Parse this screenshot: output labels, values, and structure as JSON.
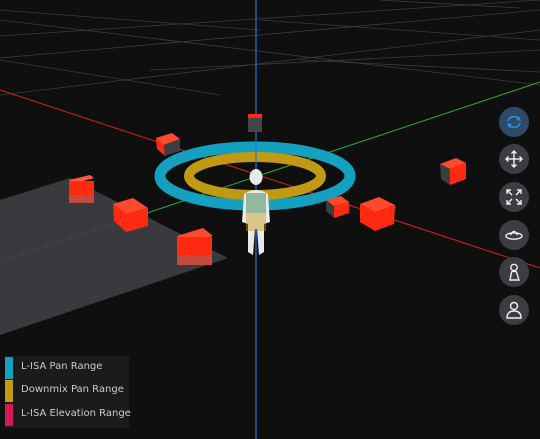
{
  "colors": {
    "background": "#0f0f10",
    "pan_range": "#13a1bf",
    "downmix_range": "#c09a12",
    "elevation_range": "#d01a5a",
    "source_red": "#ff2a10",
    "tool_active": "#2a8ad8"
  },
  "legend": {
    "items": [
      {
        "label": "L-ISA Pan Range",
        "color": "#13a1bf"
      },
      {
        "label": "Downmix Pan Range",
        "color": "#c09a12"
      },
      {
        "label": "L-ISA Elevation Range",
        "color": "#d01a5a"
      }
    ]
  },
  "toolbar": {
    "buttons": [
      {
        "name": "orbit-toggle",
        "icon": "orbit-arrows-icon",
        "active": true
      },
      {
        "name": "pan-move",
        "icon": "move-arrows-icon",
        "active": false
      },
      {
        "name": "fit-view",
        "icon": "expand-corners-icon",
        "active": false
      },
      {
        "name": "top-view",
        "icon": "eye-ring-icon",
        "active": false
      },
      {
        "name": "listener-side",
        "icon": "listener-side-icon",
        "active": false
      },
      {
        "name": "listener-front",
        "icon": "listener-front-icon",
        "active": false
      }
    ]
  }
}
